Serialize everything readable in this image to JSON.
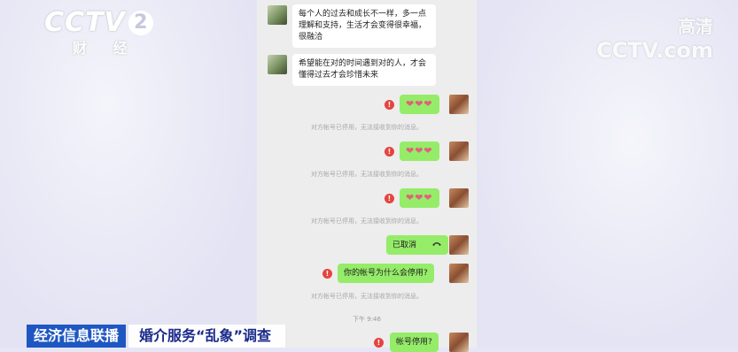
{
  "overlay": {
    "channel_logo_text": "CCTV",
    "channel_number": "2",
    "channel_sub": "财 经",
    "hd_label": "高清",
    "hd_logo_text": "CCTV.com"
  },
  "chat": {
    "messages": [
      {
        "text": "每个人的过去和成长不一样，多一点理解和支持，生活才会变得很幸福，很融洽"
      },
      {
        "text": "希望能在对的时间遇到对的人，才会懂得过去才会珍惜未来"
      },
      {
        "text": "❤❤❤"
      },
      {
        "text": "❤❤❤"
      },
      {
        "text": "❤❤❤"
      },
      {
        "text": "已取消",
        "icon": "phone-hangup-icon"
      },
      {
        "text": "你的帐号为什么会停用?"
      },
      {
        "text": "帐号停用?"
      }
    ],
    "system_notice": "对方帐号已停用，无法接收到你的消息。",
    "timestamp": "下午 9:46",
    "error_mark": "!"
  },
  "banner": {
    "program": "经济信息联播",
    "topic": "婚介服务“乱象”调查"
  },
  "colors": {
    "bubble_green": "#95ec69",
    "error_red": "#e64340",
    "banner_blue": "#1f57c2"
  }
}
